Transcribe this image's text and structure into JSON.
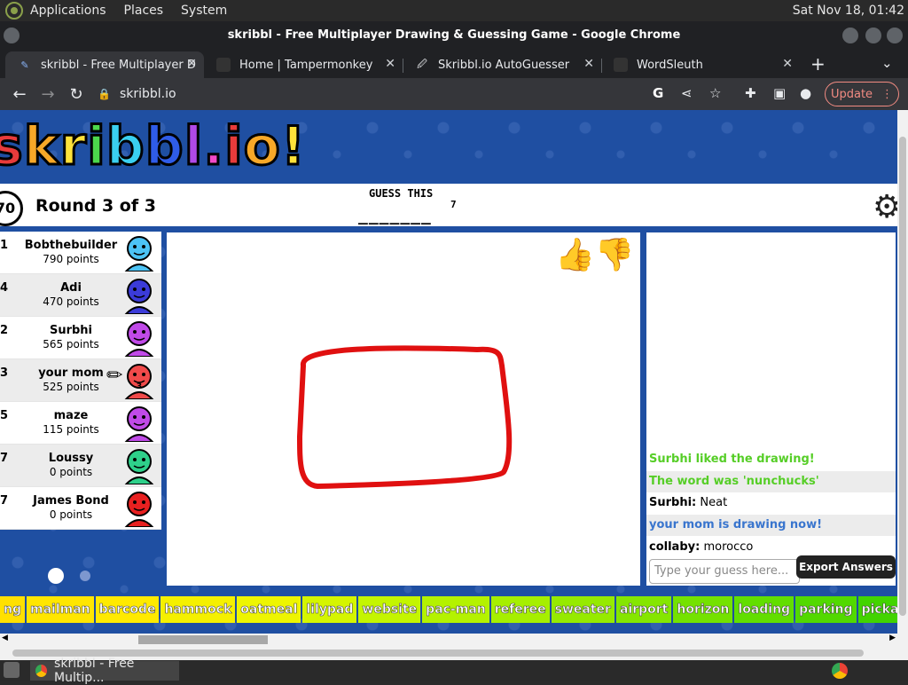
{
  "os": {
    "menus": [
      "Applications",
      "Places",
      "System"
    ],
    "clock": "Sat Nov 18, 01:42"
  },
  "window": {
    "title": "skribbl - Free Multiplayer Drawing & Guessing Game - Google Chrome"
  },
  "tabs": [
    {
      "label": "skribbl - Free Multiplayer D"
    },
    {
      "label": "Home | Tampermonkey"
    },
    {
      "label": "Skribbl.io AutoGuesser"
    },
    {
      "label": "WordSleuth"
    }
  ],
  "toolbar": {
    "url": "skribbl.io",
    "update_label": "Update"
  },
  "game": {
    "logo": "skribbl.io",
    "timer": "70",
    "round": "Round 3 of 3",
    "guess_label": "GUESS THIS",
    "blanks": "_______",
    "word_length": "7",
    "players": [
      {
        "rank": "1",
        "name": "Bobthebuilder",
        "points": "790 points",
        "color": "#4cc3f5"
      },
      {
        "rank": "4",
        "name": "Adi",
        "points": "470 points",
        "color": "#3b3bd8"
      },
      {
        "rank": "2",
        "name": "Surbhi",
        "points": "565 points",
        "color": "#c04ae8"
      },
      {
        "rank": "3",
        "name": "your mom",
        "points": "525 points",
        "color": "#f04a4a"
      },
      {
        "rank": "5",
        "name": "maze",
        "points": "115 points",
        "color": "#c04ae8"
      },
      {
        "rank": "7",
        "name": "Loussy",
        "points": "0 points",
        "color": "#2ed08a"
      },
      {
        "rank": "7",
        "name": "James Bond",
        "points": "0 points",
        "color": "#e82020"
      }
    ],
    "drawer_rank_label": "3",
    "chat": [
      {
        "text": "Surbhi liked the drawing!"
      },
      {
        "text": "The word was 'nunchucks'"
      },
      {
        "user": "Surbhi:",
        "text": "Neat"
      },
      {
        "text": "your mom is drawing now!"
      },
      {
        "user": "collaby:",
        "text": "morocco"
      }
    ],
    "guess_placeholder": "Type your guess here...",
    "export_label": "Export Answers"
  },
  "answers": [
    {
      "word": "ng",
      "color": "#ffe000"
    },
    {
      "word": "mailman",
      "color": "#ffe600"
    },
    {
      "word": "barcode",
      "color": "#ffea00"
    },
    {
      "word": "hammock",
      "color": "#f5f000"
    },
    {
      "word": "oatmeal",
      "color": "#eef500"
    },
    {
      "word": "lilypad",
      "color": "#d5f500"
    },
    {
      "word": "website",
      "color": "#c4f500"
    },
    {
      "word": "pac-man",
      "color": "#b4f200"
    },
    {
      "word": "referee",
      "color": "#a6ef00"
    },
    {
      "word": "sweater",
      "color": "#96ea00"
    },
    {
      "word": "airport",
      "color": "#85e600"
    },
    {
      "word": "horizon",
      "color": "#74e200"
    },
    {
      "word": "loading",
      "color": "#62de00"
    },
    {
      "word": "parking",
      "color": "#52d900"
    },
    {
      "word": "pickaxe",
      "color": "#42d400"
    }
  ],
  "taskbar": {
    "task": "skribbl - Free Multip..."
  }
}
